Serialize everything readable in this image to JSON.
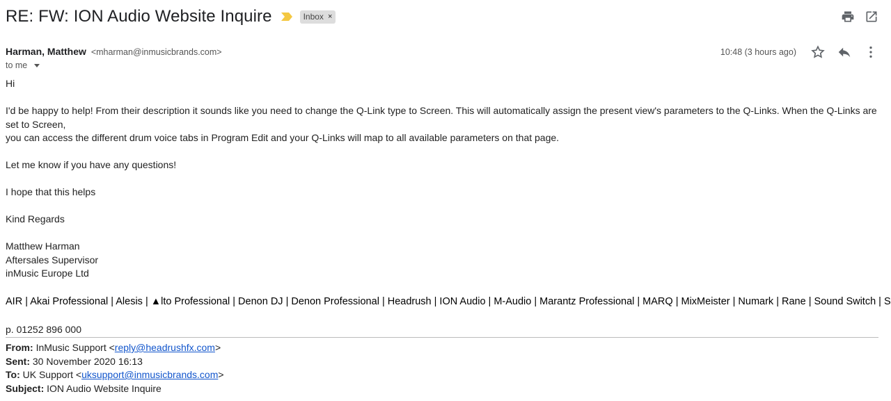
{
  "email": {
    "subject": "RE: FW: ION Audio Website Inquire",
    "label": "Inbox",
    "label_remove": "×",
    "sender_name": "Harman, Matthew",
    "sender_email": "<mharman@inmusicbrands.com>",
    "to_text": "to me",
    "timestamp": "10:48 (3 hours ago)"
  },
  "body": {
    "greeting": "Hi",
    "paragraph1_line1": "I'd be happy to help! From their description it sounds like you need to change the Q-Link type to Screen. This will automatically assign the present view's parameters to the Q-Links. When the Q-Links are set to Screen,",
    "paragraph1_line2": "you can access the different drum voice tabs in Program Edit and your Q-Links will map to all available parameters on that page.",
    "paragraph2": "Let me know if you have any questions!",
    "paragraph3": "I hope that this helps",
    "closing": "Kind Regards",
    "sig_name": "Matthew Harman",
    "sig_title": "Aftersales Supervisor",
    "sig_company": "inMusic Europe Ltd",
    "brands_line": "AIR | Akai Professional | Alesis | ▲lto Professional | Denon DJ | Denon Professional | Headrush | ION Audio | M-Audio | Marantz Professional | MARQ | MixMeister | Numark | Rane | Sound Switch | Sonivox*",
    "phone": "p. 01252 896 000"
  },
  "forwarded": {
    "from_label": "From:",
    "from_name": "InMusic Support <",
    "from_email": "reply@headrushfx.com",
    "from_close": ">",
    "sent_label": "Sent:",
    "sent_value": "30 November 2020 16:13",
    "to_label": "To:",
    "to_name": "UK Support <",
    "to_email": "uksupport@inmusicbrands.com",
    "to_close": ">",
    "subject_label": "Subject:",
    "subject_value": "ION Audio Website Inquire"
  },
  "icons": {
    "print": "print-icon",
    "open_new_window": "open-in-new-window-icon",
    "star": "star-icon",
    "reply": "reply-icon",
    "more": "more-vert-icon",
    "important": "importance-marker-icon",
    "dropdown": "chevron-down-icon"
  },
  "colors": {
    "important_marker": "#f4c842",
    "link": "#1155cc",
    "label_chip_bg": "#dddddd"
  }
}
